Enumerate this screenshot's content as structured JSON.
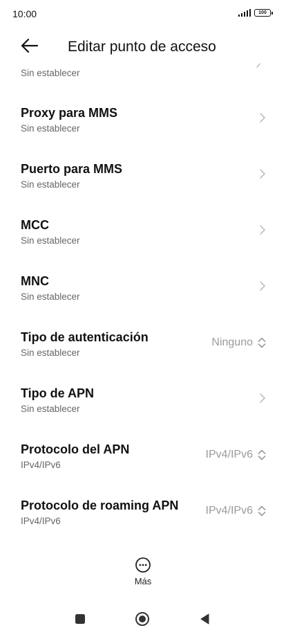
{
  "status_bar": {
    "time": "10:00",
    "battery_level": "100"
  },
  "header": {
    "title": "Editar punto de acceso",
    "back_icon": "arrow-left-icon"
  },
  "partial_item": {
    "summary": "Sin establecer"
  },
  "items": [
    {
      "title": "Proxy para MMS",
      "summary": "Sin establecer",
      "value": "",
      "control": "chevron-right"
    },
    {
      "title": "Puerto para MMS",
      "summary": "Sin establecer",
      "value": "",
      "control": "chevron-right"
    },
    {
      "title": "MCC",
      "summary": "Sin establecer",
      "value": "",
      "control": "chevron-right"
    },
    {
      "title": "MNC",
      "summary": "Sin establecer",
      "value": "",
      "control": "chevron-right"
    },
    {
      "title": "Tipo de autenticación",
      "summary": "Sin establecer",
      "value": "Ninguno",
      "control": "up-down"
    },
    {
      "title": "Tipo de APN",
      "summary": "Sin establecer",
      "value": "",
      "control": "chevron-right"
    },
    {
      "title": "Protocolo del APN",
      "summary": "IPv4/IPv6",
      "value": "IPv4/IPv6",
      "control": "up-down"
    },
    {
      "title": "Protocolo de roaming APN",
      "summary": "IPv4/IPv6",
      "value": "IPv4/IPv6",
      "control": "up-down"
    }
  ],
  "more_button": {
    "label": "Más",
    "icon": "more-horiz-circle-icon"
  },
  "nav_bar": {
    "recents_icon": "square-icon",
    "home_icon": "circle-icon",
    "back_icon": "triangle-back-icon"
  }
}
